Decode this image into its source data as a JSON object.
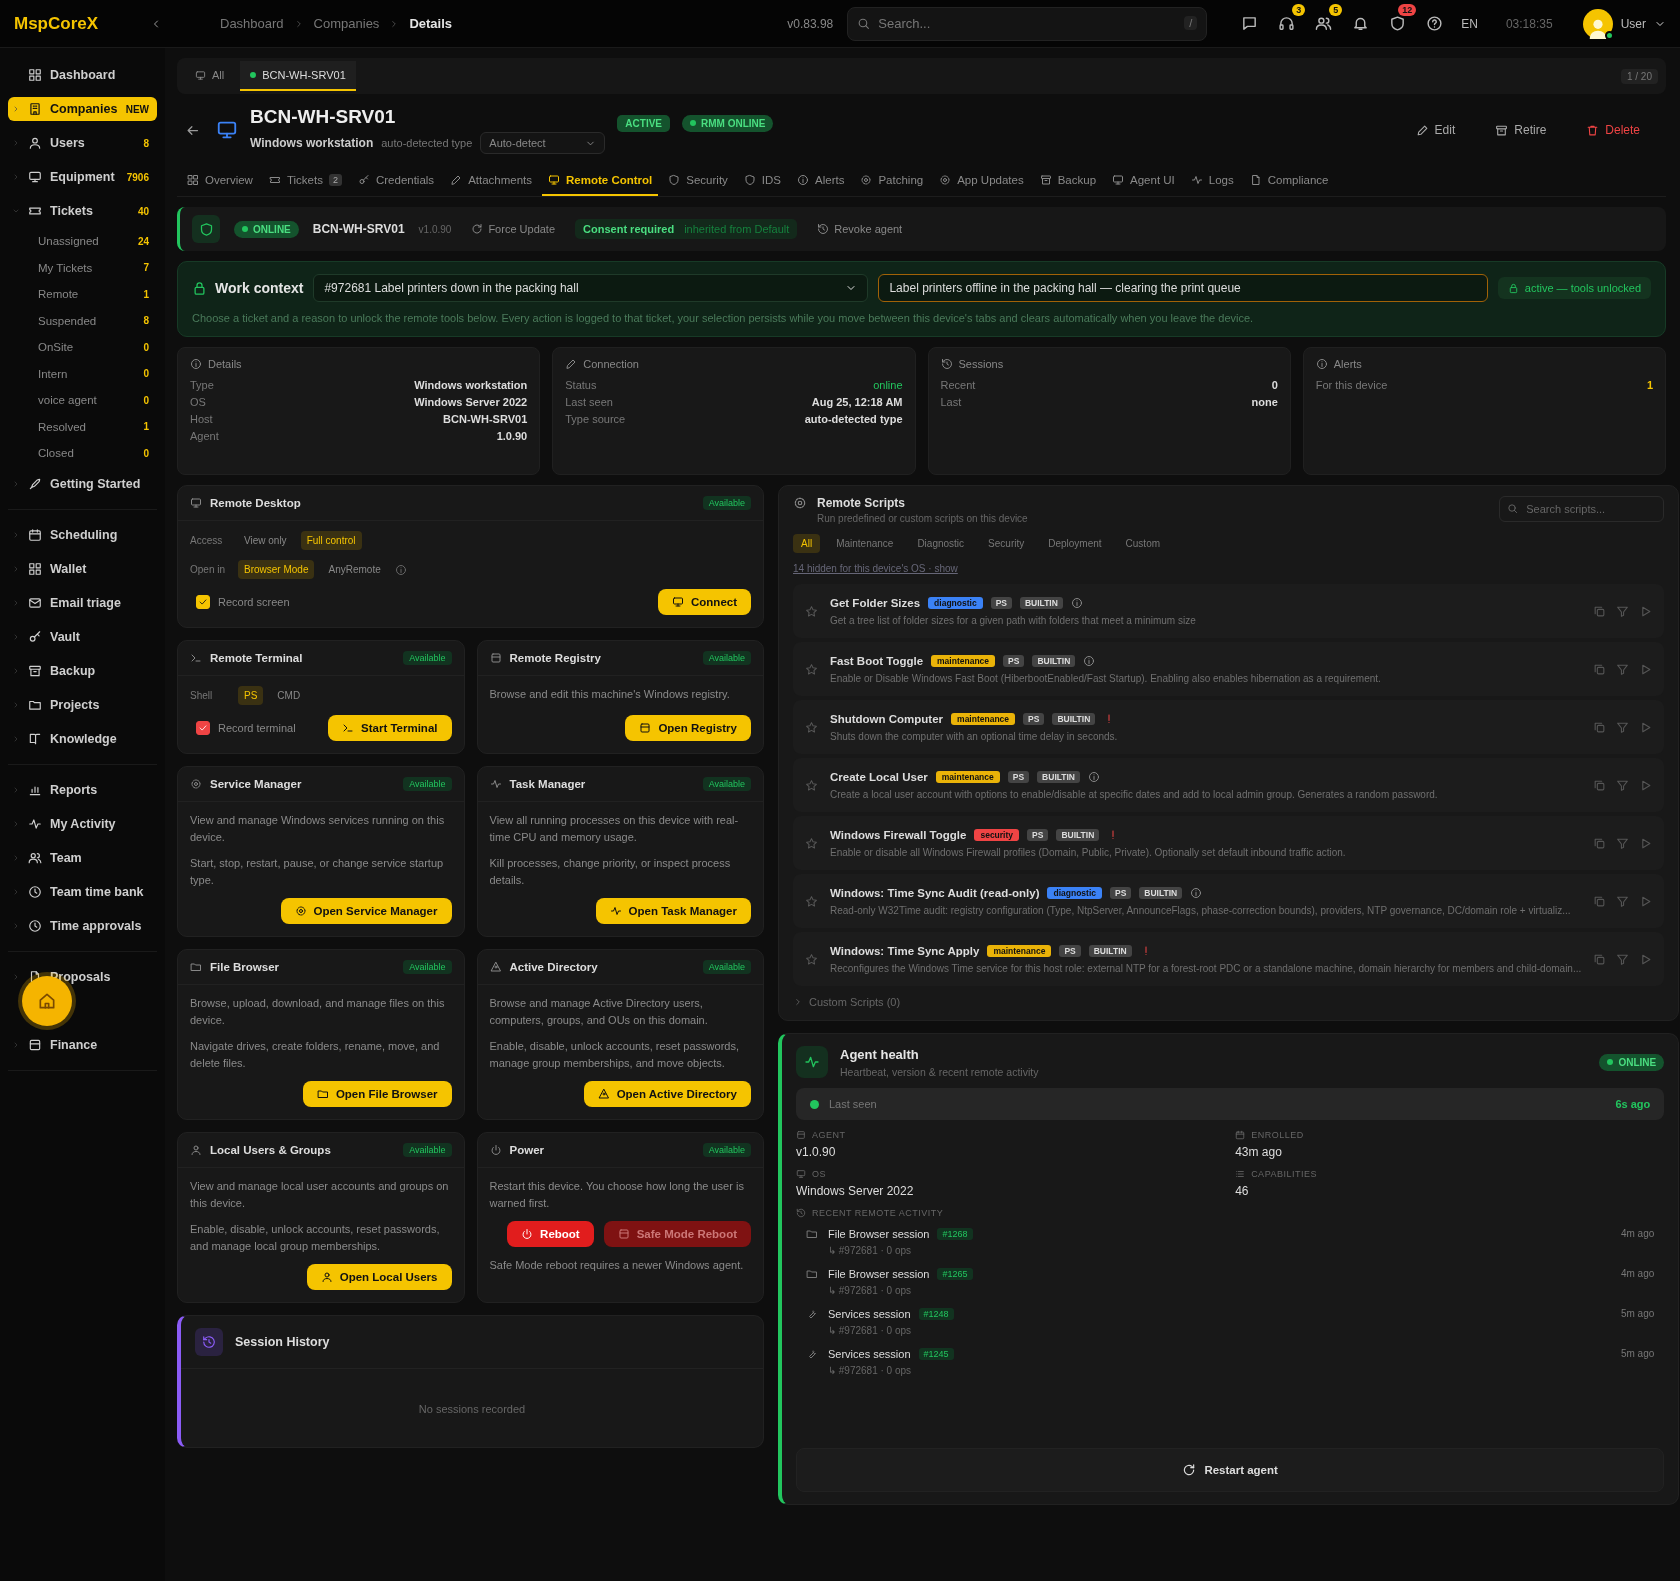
{
  "topbar": {
    "logo": "MspCoreX",
    "breadcrumbs": [
      "Dashboard",
      "Companies",
      "Details"
    ],
    "version": "v0.83.98",
    "search": {
      "placeholder": "Search...",
      "shortcut": "/"
    },
    "icons": [
      {
        "kind": "chat"
      },
      {
        "kind": "headset",
        "badge": "3",
        "color": "#f5c400"
      },
      {
        "kind": "users",
        "badge": "5",
        "color": "#f5c400"
      },
      {
        "kind": "bell"
      },
      {
        "kind": "shield",
        "badge": "12",
        "color": "#ef4444"
      },
      {
        "kind": "help"
      }
    ],
    "language": "EN",
    "clock": "03:18:35",
    "user": {
      "name": "User",
      "online": true
    }
  },
  "sidebar": {
    "sections": [
      {
        "items": [
          {
            "label": "Dashboard",
            "selected": false
          },
          {
            "label": "Companies",
            "count": "NEW",
            "selected": true,
            "expanded": false
          },
          {
            "label": "Users",
            "count": "8",
            "selected": false,
            "expanded": false
          },
          {
            "label": "Equipment",
            "count": "7906",
            "selected": false,
            "expanded": false
          },
          {
            "label": "Tickets",
            "count": "40",
            "selected": false,
            "expanded": true,
            "children": [
              {
                "label": "Unassigned",
                "count": "24",
                "selected": false
              },
              {
                "label": "My Tickets",
                "count": "7",
                "selected": false
              },
              {
                "label": "Remote",
                "count": "1",
                "selected": false
              },
              {
                "label": "Suspended",
                "count": "8",
                "selected": false
              },
              {
                "label": "OnSite",
                "count": "0",
                "selected": false
              },
              {
                "label": "Intern",
                "count": "0",
                "selected": false
              },
              {
                "label": "voice agent",
                "count": "0",
                "selected": false
              },
              {
                "label": "Resolved",
                "count": "1",
                "selected": false
              },
              {
                "label": "Closed",
                "count": "0",
                "selected": false
              }
            ]
          },
          {
            "label": "Getting Started",
            "selected": false,
            "expanded": false
          }
        ]
      },
      {
        "items": [
          {
            "label": "Scheduling",
            "selected": false,
            "expanded": false
          },
          {
            "label": "Wallet",
            "selected": false,
            "expanded": false
          },
          {
            "label": "Email triage",
            "selected": false,
            "expanded": false
          },
          {
            "label": "Vault",
            "selected": false,
            "expanded": false
          },
          {
            "label": "Backup",
            "selected": false,
            "expanded": false
          },
          {
            "label": "Projects",
            "selected": false,
            "expanded": false
          },
          {
            "label": "Knowledge",
            "selected": false,
            "expanded": false
          }
        ]
      },
      {
        "items": [
          {
            "label": "Reports",
            "selected": false,
            "expanded": false
          },
          {
            "label": "My Activity",
            "selected": false,
            "expanded": false
          },
          {
            "label": "Team",
            "selected": false,
            "expanded": false
          },
          {
            "label": "Team time bank",
            "selected": false,
            "expanded": false
          },
          {
            "label": "Time approvals",
            "selected": false,
            "expanded": false
          }
        ]
      },
      {
        "items": [
          {
            "label": "Proposals",
            "selected": false,
            "expanded": false
          },
          {
            "label": "Finance",
            "selected": false,
            "expanded": false
          }
        ]
      }
    ]
  },
  "device_tabs": {
    "items": [
      {
        "label": "All",
        "selected": false
      },
      {
        "label": "BCN-WH-SRV01",
        "online": true,
        "selected": true
      }
    ],
    "pager": "1 / 20"
  },
  "header": {
    "title": "BCN-WH-SRV01",
    "type": "Windows workstation",
    "type_note": "auto-detected type",
    "type_select": "Auto-detect",
    "badges": [
      {
        "label": "ACTIVE",
        "kind": "plain"
      },
      {
        "label": "RMM ONLINE",
        "kind": "dot"
      }
    ],
    "actions": [
      {
        "label": "Edit",
        "kind": "normal"
      },
      {
        "label": "Retire",
        "kind": "normal"
      },
      {
        "label": "Delete",
        "kind": "danger"
      }
    ]
  },
  "nav_tabs": [
    {
      "label": "Overview",
      "selected": false
    },
    {
      "label": "Tickets",
      "count": "2",
      "selected": false
    },
    {
      "label": "Credentials",
      "selected": false
    },
    {
      "label": "Attachments",
      "selected": false
    },
    {
      "label": "Remote Control",
      "selected": true
    },
    {
      "label": "Security",
      "selected": false
    },
    {
      "label": "IDS",
      "selected": false
    },
    {
      "label": "Alerts",
      "selected": false
    },
    {
      "label": "Patching",
      "selected": false
    },
    {
      "label": "App Updates",
      "selected": false
    },
    {
      "label": "Backup",
      "selected": false
    },
    {
      "label": "Agent UI",
      "selected": false
    },
    {
      "label": "Logs",
      "selected": false
    },
    {
      "label": "Compliance",
      "selected": false
    }
  ],
  "agent_bar": {
    "status": "ONLINE",
    "host": "BCN-WH-SRV01",
    "version": "v1.0.90",
    "update": "Force Update",
    "consent": "Consent required",
    "consent_note": "inherited from Default",
    "revoke": "Revoke agent"
  },
  "work_context": {
    "title": "Work context",
    "ticket": "#972681 Label printers down in the packing hall",
    "reason": "Label printers offline in the packing hall — clearing the print queue",
    "state": "active — tools unlocked",
    "help": "Choose a ticket and a reason to unlock the remote tools below. Every action is logged to that ticket, your selection persists while you move between this device's tabs and clears automatically when you leave the device."
  },
  "info_cards": [
    {
      "title": "Details",
      "rows": [
        {
          "label": "Type",
          "value": "Windows workstation"
        },
        {
          "label": "OS",
          "value": "Windows Server 2022"
        },
        {
          "label": "Host",
          "value": "BCN-WH-SRV01"
        },
        {
          "label": "Agent",
          "value": "1.0.90"
        }
      ]
    },
    {
      "title": "Connection",
      "rows": [
        {
          "label": "Status",
          "value": "online",
          "kind": "status"
        },
        {
          "label": "Last seen",
          "value": "Aug 25, 12:18 AM"
        },
        {
          "label": "Type source",
          "value": "auto-detected type"
        }
      ]
    },
    {
      "title": "Sessions",
      "rows": [
        {
          "label": "Recent",
          "value": "0"
        },
        {
          "label": "Last",
          "value": "none"
        }
      ]
    },
    {
      "title": "Alerts",
      "rows": [
        {
          "label": "For this device",
          "value": "1",
          "kind": "alert"
        }
      ]
    }
  ],
  "remote_desktop": {
    "title": "Remote Desktop",
    "status": "Available",
    "options": [
      {
        "label": "Access",
        "choices": [
          {
            "label": "View only",
            "selected": false
          },
          {
            "label": "Full control",
            "selected": true
          }
        ]
      },
      {
        "label": "Open in",
        "choices": [
          {
            "label": "Browser Mode",
            "selected": true
          },
          {
            "label": "AnyRemote",
            "selected": false
          }
        ]
      }
    ],
    "checkbox": {
      "label": "Record screen",
      "checked": true
    },
    "button": "Connect"
  },
  "tools": [
    {
      "kind": "terminal",
      "title": "Remote Terminal",
      "status": "Available",
      "options": [
        {
          "label": "Shell",
          "choices": [
            {
              "label": "PS",
              "selected": true
            },
            {
              "label": "CMD",
              "selected": false
            }
          ]
        }
      ],
      "checkbox": {
        "label": "Record terminal",
        "checked": true
      },
      "button": "Start Terminal"
    },
    {
      "kind": "simple",
      "title": "Remote Registry",
      "status": "Available",
      "paragraphs": [
        "Browse and edit this machine's Windows registry."
      ],
      "button": "Open Registry"
    },
    {
      "kind": "simple",
      "title": "Service Manager",
      "status": "Available",
      "paragraphs": [
        "View and manage Windows services running on this device.",
        "Start, stop, restart, pause, or change service startup type."
      ],
      "button": "Open Service Manager"
    },
    {
      "kind": "simple",
      "title": "Task Manager",
      "status": "Available",
      "paragraphs": [
        "View all running processes on this device with real-time CPU and memory usage.",
        "Kill processes, change priority, or inspect process details."
      ],
      "button": "Open Task Manager"
    },
    {
      "kind": "simple",
      "title": "File Browser",
      "status": "Available",
      "paragraphs": [
        "Browse, upload, download, and manage files on this device.",
        "Navigate drives, create folders, rename, move, and delete files."
      ],
      "button": "Open File Browser"
    },
    {
      "kind": "simple",
      "title": "Active Directory",
      "status": "Available",
      "paragraphs": [
        "Browse and manage Active Directory users, computers, groups, and OUs on this domain.",
        "Enable, disable, unlock accounts, reset passwords, manage group memberships, and move objects."
      ],
      "button": "Open Active Directory"
    },
    {
      "kind": "simple",
      "title": "Local Users & Groups",
      "status": "Available",
      "paragraphs": [
        "View and manage local user accounts and groups on this device.",
        "Enable, disable, unlock accounts, reset passwords, and manage local group memberships."
      ],
      "button": "Open Local Users"
    },
    {
      "kind": "power",
      "title": "Power",
      "status": "Available",
      "paragraphs": [
        "Restart this device. You choose how long the user is warned first."
      ],
      "buttons": [
        {
          "label": "Reboot",
          "disabled": false
        },
        {
          "label": "Safe Mode Reboot",
          "disabled": true
        }
      ],
      "note": "Safe Mode reboot requires a newer Windows agent."
    }
  ],
  "session_history": {
    "title": "Session History",
    "empty": "No sessions recorded"
  },
  "scripts": {
    "title": "Remote Scripts",
    "subtitle": "Run predefined or custom scripts on this device",
    "search": {
      "placeholder": "Search scripts..."
    },
    "filters": [
      {
        "label": "All",
        "selected": true
      },
      {
        "label": "Maintenance",
        "selected": false
      },
      {
        "label": "Diagnostic",
        "selected": false
      },
      {
        "label": "Security",
        "selected": false
      },
      {
        "label": "Deployment",
        "selected": false
      },
      {
        "label": "Custom",
        "selected": false
      }
    ],
    "hidden_note": "14 hidden for this device's OS · show",
    "items": [
      {
        "name": "Get Folder Sizes",
        "category": "diagnostic",
        "color": "#3b82f6",
        "lang": "PS",
        "source": "BUILTIN",
        "warning": false,
        "description": "Get a tree list of folder sizes for a given path with folders that meet a minimum size"
      },
      {
        "name": "Fast Boot Toggle",
        "category": "maintenance",
        "color": "#eab308",
        "lang": "PS",
        "source": "BUILTIN",
        "warning": false,
        "description": "Enable or Disable Windows Fast Boot (HiberbootEnabled/Fast Startup). Enabling also enables hibernation as a requirement."
      },
      {
        "name": "Shutdown Computer",
        "category": "maintenance",
        "color": "#eab308",
        "lang": "PS",
        "source": "BUILTIN",
        "warning": true,
        "description": "Shuts down the computer with an optional time delay in seconds."
      },
      {
        "name": "Create Local User",
        "category": "maintenance",
        "color": "#eab308",
        "lang": "PS",
        "source": "BUILTIN",
        "warning": false,
        "description": "Create a local user account with options to enable/disable at specific dates and add to local admin group. Generates a random password."
      },
      {
        "name": "Windows Firewall Toggle",
        "category": "security",
        "color": "#ef4444",
        "lang": "PS",
        "source": "BUILTIN",
        "warning": true,
        "description": "Enable or disable all Windows Firewall profiles (Domain, Public, Private). Optionally set default inbound traffic action."
      },
      {
        "name": "Windows: Time Sync Audit (read-only)",
        "category": "diagnostic",
        "color": "#3b82f6",
        "lang": "PS",
        "source": "BUILTIN",
        "warning": false,
        "description": "Read-only W32Time audit: registry configuration (Type, NtpServer, AnnounceFlags, phase-correction bounds), providers, NTP governance, DC/domain role + virtualiz..."
      },
      {
        "name": "Windows: Time Sync Apply",
        "category": "maintenance",
        "color": "#eab308",
        "lang": "PS",
        "source": "BUILTIN",
        "warning": true,
        "description": "Reconfigures the Windows Time service for this host role: external NTP for a forest-root PDC or a standalone machine, domain hierarchy for members and child-domain..."
      }
    ],
    "custom": "Custom Scripts (0)",
    "custom_expanded": false
  },
  "agent_health": {
    "title": "Agent health",
    "subtitle": "Heartbeat, version & recent remote activity",
    "status": "ONLINE",
    "last_seen_label": "Last seen",
    "last_seen": "6s ago",
    "facts": [
      {
        "label": "AGENT",
        "value": "v1.0.90"
      },
      {
        "label": "ENROLLED",
        "value": "43m ago"
      },
      {
        "label": "OS",
        "value": "Windows Server 2022"
      },
      {
        "label": "CAPABILITIES",
        "value": "46"
      }
    ],
    "activity_title": "RECENT REMOTE ACTIVITY",
    "activity": [
      {
        "title": "File Browser session",
        "ref": "#1268",
        "detail": "↳ #972681 · 0 ops",
        "time": "4m ago"
      },
      {
        "title": "File Browser session",
        "ref": "#1265",
        "detail": "↳ #972681 · 0 ops",
        "time": "4m ago"
      },
      {
        "title": "Services session",
        "ref": "#1248",
        "detail": "↳ #972681 · 0 ops",
        "time": "5m ago"
      },
      {
        "title": "Services session",
        "ref": "#1245",
        "detail": "↳ #972681 · 0 ops",
        "time": "5m ago"
      }
    ],
    "restart": "Restart agent"
  }
}
